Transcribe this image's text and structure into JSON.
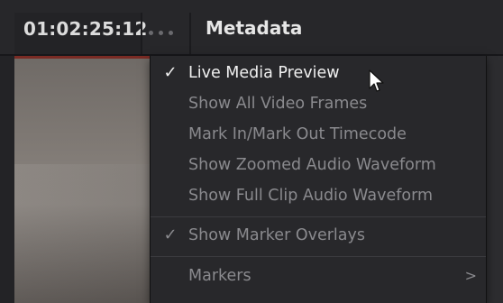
{
  "header": {
    "timecode": "01:02:25:12",
    "more_icon": "more-dots-icon",
    "panel_title": "Metadata"
  },
  "menu": {
    "items": [
      {
        "label": "Live Media Preview",
        "checked": true,
        "enabled": true
      },
      {
        "label": "Show All Video Frames",
        "checked": false,
        "enabled": false
      },
      {
        "label": "Mark In/Mark Out Timecode",
        "checked": false,
        "enabled": false
      },
      {
        "label": "Show Zoomed Audio Waveform",
        "checked": false,
        "enabled": false
      },
      {
        "label": "Show Full Clip Audio Waveform",
        "checked": false,
        "enabled": false
      },
      {
        "label": "Show Marker Overlays",
        "checked": true,
        "enabled": false
      },
      {
        "label": "Markers",
        "checked": false,
        "enabled": false,
        "submenu": true
      }
    ],
    "check_glyph": "✓",
    "submenu_glyph": ">"
  },
  "colors": {
    "menu_bg": "#28282b",
    "active_text": "#f0f0f0",
    "disabled_text": "#8a8a8e",
    "header_text": "#e6e6e6"
  }
}
